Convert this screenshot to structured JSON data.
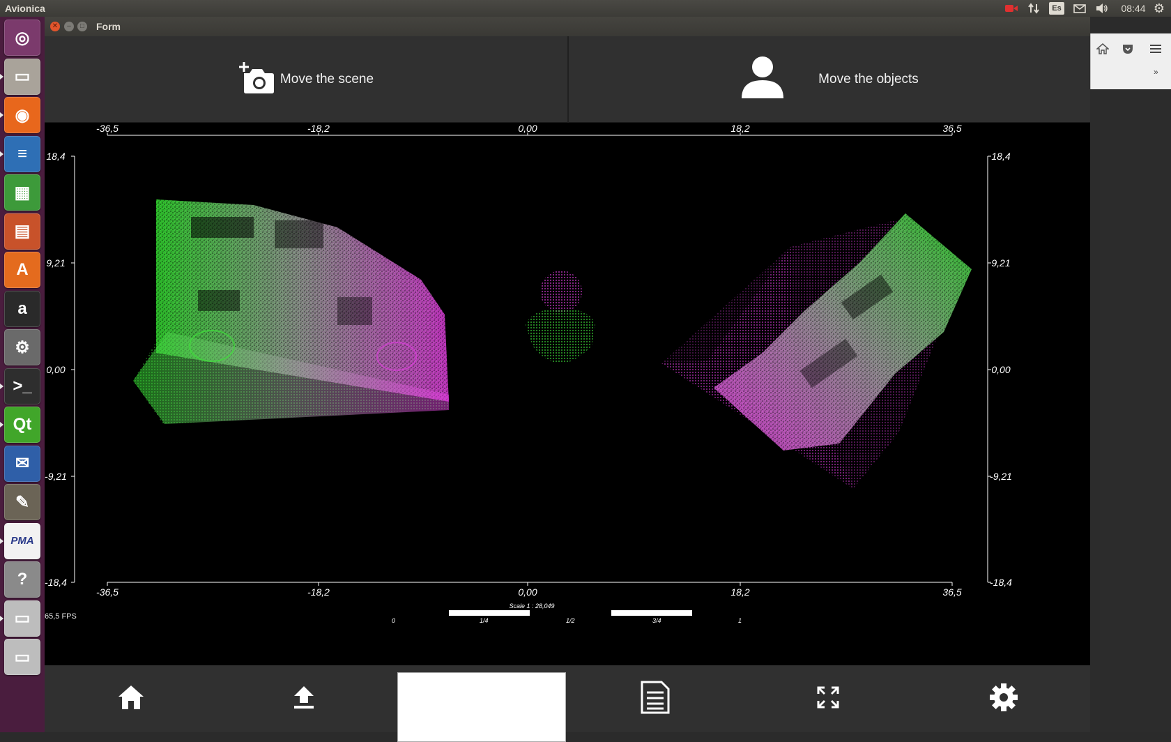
{
  "panel": {
    "app_name": "Avionica",
    "keyboard_layout": "Es",
    "clock": "08:44",
    "icons": [
      "record-icon",
      "network-icon",
      "keyboard-icon",
      "mail-icon",
      "volume-icon",
      "gear-icon"
    ]
  },
  "launcher": {
    "items": [
      {
        "name": "ubuntu-dash",
        "glyph": "◎",
        "bg": "#7b3a6c"
      },
      {
        "name": "files",
        "glyph": "▭",
        "bg": "#a9a39a"
      },
      {
        "name": "firefox",
        "glyph": "◉",
        "bg": "#e8671c"
      },
      {
        "name": "writer",
        "glyph": "≡",
        "bg": "#2e6fb5"
      },
      {
        "name": "calc",
        "glyph": "▦",
        "bg": "#3d9a3a"
      },
      {
        "name": "impress",
        "glyph": "▤",
        "bg": "#c8522a"
      },
      {
        "name": "software-center",
        "glyph": "A",
        "bg": "#e46b1e"
      },
      {
        "name": "amazon",
        "glyph": "a",
        "bg": "#2a2a2a"
      },
      {
        "name": "system-settings",
        "glyph": "⚙",
        "bg": "#6a6a6a"
      },
      {
        "name": "terminal",
        "glyph": ">_",
        "bg": "#2e2e2e"
      },
      {
        "name": "qt-creator",
        "glyph": "Qt",
        "bg": "#41a62a"
      },
      {
        "name": "thunderbird",
        "glyph": "✉",
        "bg": "#2f5fa8"
      },
      {
        "name": "gimp",
        "glyph": "✎",
        "bg": "#6b6456"
      },
      {
        "name": "pma",
        "glyph": "PMA",
        "bg": "#f2f2f2"
      },
      {
        "name": "help",
        "glyph": "?",
        "bg": "#8a8a8a"
      },
      {
        "name": "disk-1",
        "glyph": "▭",
        "bg": "#bdbdbd"
      },
      {
        "name": "disk-2",
        "glyph": "▭",
        "bg": "#bdbdbd"
      }
    ]
  },
  "window": {
    "title": "Form",
    "mode_buttons": [
      {
        "label": "Move the scene",
        "icon": "add-camera-icon"
      },
      {
        "label": "Move the objects",
        "icon": "person-icon"
      }
    ]
  },
  "viewport": {
    "x_ticks": [
      "-36,5",
      "-18,2",
      "0,00",
      "18,2",
      "36,5"
    ],
    "y_ticks": [
      "18,4",
      "9,21",
      "0,00",
      "-9,21",
      "-18,4"
    ],
    "scale_label": "Scale 1 : 28,049",
    "scale_ticks": [
      "0",
      "1/4",
      "1/2",
      "3/4",
      "1"
    ],
    "fps": "65,5 FPS",
    "colors": {
      "green": "#3ee03a",
      "magenta": "#e23ee2",
      "grey": "#9a9a9a"
    }
  },
  "bottom_bar": {
    "buttons": [
      "home-icon",
      "upload-icon",
      "import-area",
      "document-icon",
      "fullscreen-icon",
      "settings-icon"
    ]
  }
}
